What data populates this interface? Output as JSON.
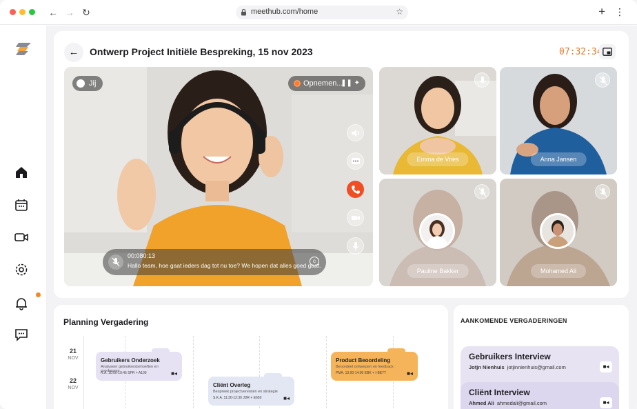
{
  "browser": {
    "url": "meethub.com/home"
  },
  "call": {
    "title": "Ontwerp Project Initiële Bespreking, 15 nov 2023",
    "timer": "07:32:34",
    "you_label": "Jij",
    "recording_label": "Opnemen...",
    "caption_time": "00:080:13",
    "caption_text": "Hallo team, hoe gaat ieders dag tot nu toe? We hopen dat alles goed gaat.",
    "participants": [
      {
        "name": "Emma de Vries"
      },
      {
        "name": "Anna Jansen"
      },
      {
        "name": "Pauline Bakker"
      },
      {
        "name": "Mohamed Ali"
      }
    ]
  },
  "planning": {
    "title": "Planning Vergadering",
    "days": [
      {
        "num": "21",
        "month": "NOV"
      },
      {
        "num": "22",
        "month": "NOV"
      }
    ],
    "events": [
      {
        "title": "Gebruikers Onderzoek",
        "subtitle": "Analyseer gebruikersbehoeften en voorkeuren",
        "meta": "R.A. 10:00-10:45    SPR + A100",
        "color": "#e6e1f3"
      },
      {
        "title": "Cliënt Overleg",
        "subtitle": "Bespreek projectvereisten en strategie",
        "meta": "S.K.A. 11:30-12:30    JDR + E650",
        "color": "#e3e6f3"
      },
      {
        "title": "Product Beoordeling",
        "subtitle": "Beoordeel ontwerpen en feedback",
        "meta": "PMA. 13:00-14:00    EBK + I-BETT",
        "color": "#f6b45a"
      }
    ]
  },
  "upcoming": {
    "title": "AANKOMENDE VERGADERINGEN",
    "items": [
      {
        "name": "Gebruikers Interview",
        "person": "Jotjn Nienhuis",
        "email": "jotjinnienhuis@gmail.com",
        "color": "#e8e3f2"
      },
      {
        "name": "Cliënt Interview",
        "person": "Ahmed Ali",
        "email": "ahmedali@gmail.com",
        "color": "#ddd6ef"
      }
    ]
  },
  "colors": {
    "accent_orange": "#e8782a",
    "end_call_red": "#f04e23"
  }
}
